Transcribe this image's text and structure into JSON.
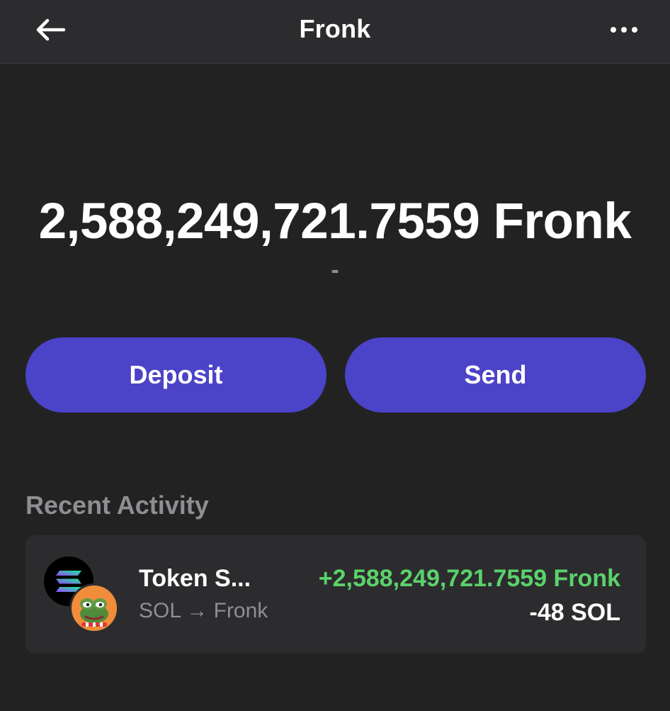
{
  "header": {
    "title": "Fronk",
    "back_icon": "arrow-left-icon",
    "more_icon": "more-horizontal-icon"
  },
  "balance": {
    "amount": "2,588,249,721.7559 Fronk",
    "fiat": "-"
  },
  "actions": {
    "deposit_label": "Deposit",
    "send_label": "Send",
    "accent_color": "#4b43c8"
  },
  "recent_activity": {
    "title": "Recent Activity",
    "items": [
      {
        "title": "Token S...",
        "subtitle": "SOL → Fronk",
        "amount": "+2,588,249,721.7559 Fronk",
        "cost": "-48 SOL",
        "amount_color": "#5bd26b",
        "icons": [
          "solana-token-icon",
          "fronk-token-icon"
        ]
      }
    ]
  }
}
